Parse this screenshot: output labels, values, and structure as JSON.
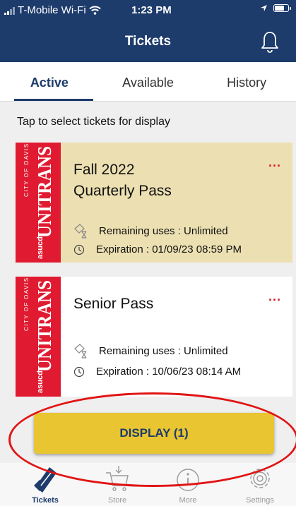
{
  "status_bar": {
    "carrier": "T-Mobile Wi-Fi",
    "time": "1:23 PM"
  },
  "header": {
    "title": "Tickets"
  },
  "tabs": [
    {
      "label": "Active",
      "active": true
    },
    {
      "label": "Available",
      "active": false
    },
    {
      "label": "History",
      "active": false
    }
  ],
  "hint": "Tap to select tickets for display",
  "tickets": [
    {
      "name_line1": "Fall 2022",
      "name_line2": "Quarterly Pass",
      "menu": "...",
      "remaining": "Remaining uses : Unlimited",
      "expiration": "Expiration : 01/09/23 08:59 PM",
      "selected": true,
      "logo": {
        "city": "CITY OF DAVIS",
        "brand": "UNITRANS",
        "prefix": "asucd"
      }
    },
    {
      "name_line1": "Senior Pass",
      "name_line2": "",
      "menu": "...",
      "remaining": "Remaining uses : Unlimited",
      "expiration": "Expiration : 10/06/23 08:14 AM",
      "selected": false,
      "logo": {
        "city": "CITY OF DAVIS",
        "brand": "UNITRANS",
        "prefix": "asucd"
      }
    }
  ],
  "display_button": "DISPLAY (1)",
  "tab_bar": [
    {
      "label": "Tickets",
      "icon": "ticket-icon",
      "active": true
    },
    {
      "label": "Store",
      "icon": "cart-icon",
      "active": false
    },
    {
      "label": "More",
      "icon": "info-icon",
      "active": false
    },
    {
      "label": "Settings",
      "icon": "gear-icon",
      "active": false
    }
  ],
  "colors": {
    "primary": "#1d3b6b",
    "accent": "#e8c531",
    "brand_red": "#e01b31",
    "selected_card": "#ece0b2",
    "annotation": "#e11414"
  }
}
